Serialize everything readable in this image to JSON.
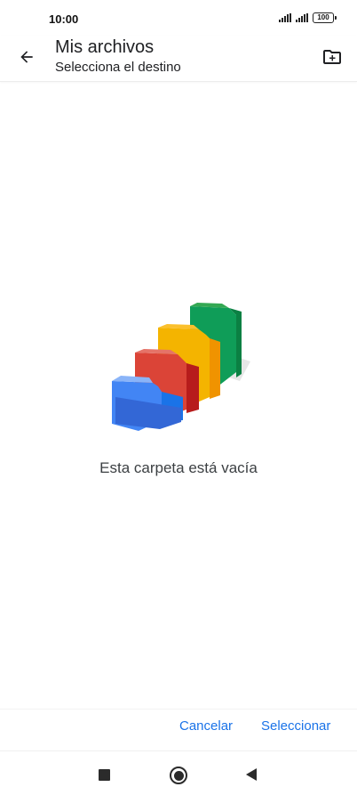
{
  "status_bar": {
    "time": "10:00",
    "battery_level": "100",
    "icons": [
      "signal-icon",
      "signal-icon",
      "battery-icon"
    ]
  },
  "app_bar": {
    "title": "Mis archivos",
    "subtitle": "Selecciona el destino",
    "back_icon": "arrow-back-icon",
    "action_icon": "create-new-folder-icon"
  },
  "empty_state": {
    "message": "Esta carpeta está vacía",
    "illustration": "colored-folders-illustration",
    "colors": [
      "#4285F4",
      "#DB4437",
      "#F4B400",
      "#0F9D58"
    ]
  },
  "actions": {
    "cancel_label": "Cancelar",
    "select_label": "Seleccionar",
    "accent_color": "#1a73e8"
  },
  "nav_bar": {
    "icons": [
      "recents-square-icon",
      "home-circle-icon",
      "back-triangle-icon"
    ]
  }
}
